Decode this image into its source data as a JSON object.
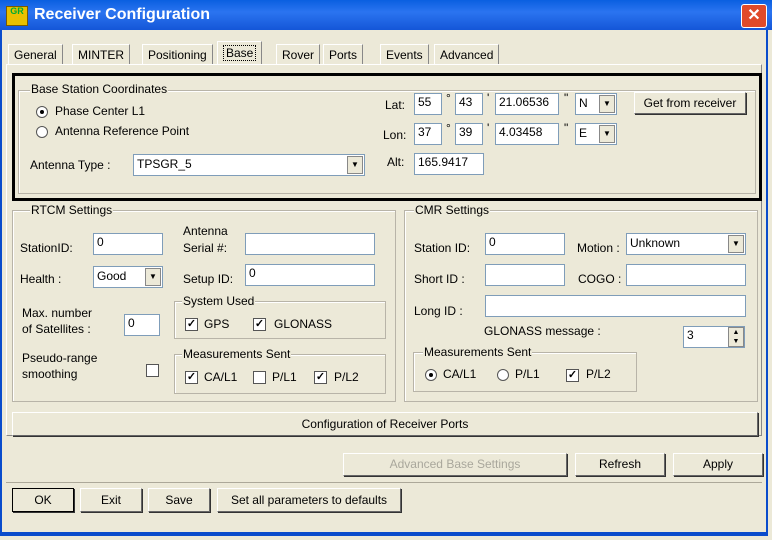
{
  "window": {
    "title": "Receiver Configuration",
    "close_glyph": "✕",
    "icon_label": "GR"
  },
  "tabs": [
    "General",
    "MINTER",
    "Positioning",
    "Base",
    "Rover",
    "Ports",
    "Events",
    "Advanced"
  ],
  "selected_tab": "Base",
  "base_station": {
    "legend": "Base Station Coordinates",
    "phase_center_label": "Phase Center L1",
    "antenna_ref_label": "Antenna Reference Point",
    "selected": "phase_center",
    "antenna_type_label": "Antenna Type :",
    "antenna_type_value": "TPSGR_5",
    "lat_label": "Lat:",
    "lat_deg": "55",
    "lat_min": "43",
    "lat_sec": "21.06536",
    "lat_dir": "N",
    "lon_label": "Lon:",
    "lon_deg": "37",
    "lon_min": "39",
    "lon_sec": "4.03458",
    "lon_dir": "E",
    "alt_label": "Alt:",
    "alt_value": "165.9417",
    "deg_symbol": "°",
    "min_symbol": "'",
    "sec_symbol": "\"",
    "get_button": "Get from receiver"
  },
  "rtcm": {
    "legend": "RTCM Settings",
    "station_id_label": "StationID:",
    "station_id_value": "0",
    "health_label": "Health :",
    "health_value": "Good",
    "max_sat_label_1": "Max. number",
    "max_sat_label_2": "of Satellites :",
    "max_sat_value": "0",
    "pseudo_label_1": "Pseudo-range",
    "pseudo_label_2": "smoothing",
    "pseudo_checked": false,
    "antenna_label_1": "Antenna",
    "antenna_label_2": "Serial #:",
    "antenna_serial_value": "",
    "setup_id_label": "Setup ID:",
    "setup_id_value": "0",
    "system_used_legend": "System Used",
    "gps_label": "GPS",
    "gps_checked": true,
    "glonass_label": "GLONASS",
    "glonass_checked": true,
    "meas_legend": "Measurements Sent",
    "ca_l1_label": "CA/L1",
    "ca_l1_checked": true,
    "p_l1_label": "P/L1",
    "p_l1_checked": false,
    "p_l2_label": "P/L2",
    "p_l2_checked": true
  },
  "cmr": {
    "legend": "CMR Settings",
    "station_id_label": "Station ID:",
    "station_id_value": "0",
    "motion_label": "Motion :",
    "motion_value": "Unknown",
    "short_id_label": "Short ID :",
    "short_id_value": "",
    "cogo_label": "COGO :",
    "cogo_value": "",
    "long_id_label": "Long ID :",
    "long_id_value": "",
    "glonass_msg_label": "GLONASS message :",
    "glonass_msg_value": "3",
    "meas_legend": "Measurements Sent",
    "ca_l1_label": "CA/L1",
    "p_l1_label": "P/L1",
    "selected": "ca_l1",
    "p_l2_label": "P/L2",
    "p_l2_checked": true
  },
  "buttons": {
    "config_ports": "Configuration of Receiver Ports",
    "advanced_base": "Advanced Base Settings",
    "refresh": "Refresh",
    "apply": "Apply",
    "ok": "OK",
    "exit": "Exit",
    "save": "Save",
    "defaults": "Set all parameters to defaults"
  },
  "glyphs": {
    "check": "✓",
    "dropdown": "▼",
    "spin_up": "▲",
    "spin_down": "▼"
  },
  "colors": {
    "title_bar": "#0a5fe0",
    "highlight_border": "#000000",
    "disabled_text": "#a9a79c"
  }
}
